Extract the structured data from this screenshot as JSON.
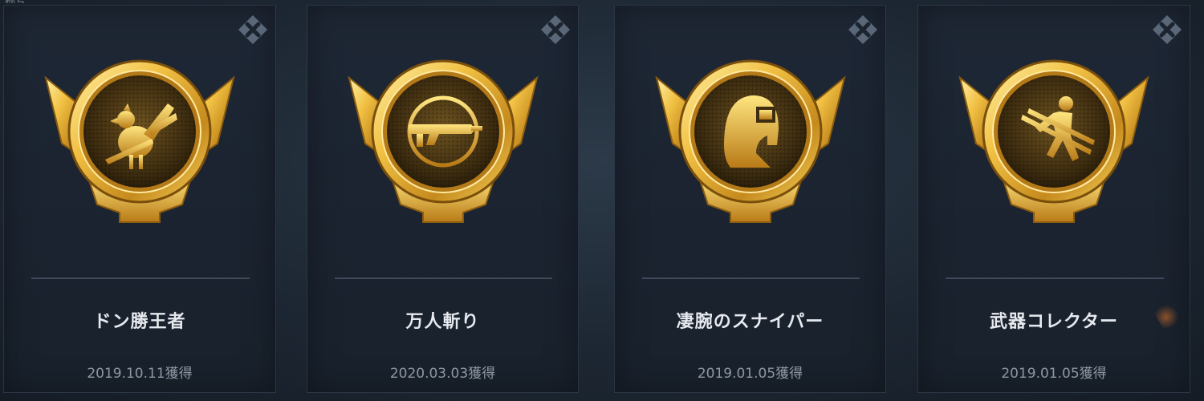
{
  "header": {
    "fragment_label": "称号"
  },
  "medals": [
    {
      "title": "ドン勝王者",
      "date": "2019.10.11獲得",
      "emblem": "chicken-icon"
    },
    {
      "title": "万人斬り",
      "date": "2020.03.03獲得",
      "emblem": "crosshair-gun-icon"
    },
    {
      "title": "凄腕のスナイパー",
      "date": "2019.01.05獲得",
      "emblem": "helmet-icon"
    },
    {
      "title": "武器コレクター",
      "date": "2019.01.05獲得",
      "emblem": "weapon-collector-icon"
    }
  ],
  "colors": {
    "gold_light": "#ffe27a",
    "gold": "#e8b331",
    "gold_dark": "#9c6a12",
    "card_bg": "#1e2735",
    "title_text": "#e6e9ee",
    "date_text": "#8e96a3"
  }
}
